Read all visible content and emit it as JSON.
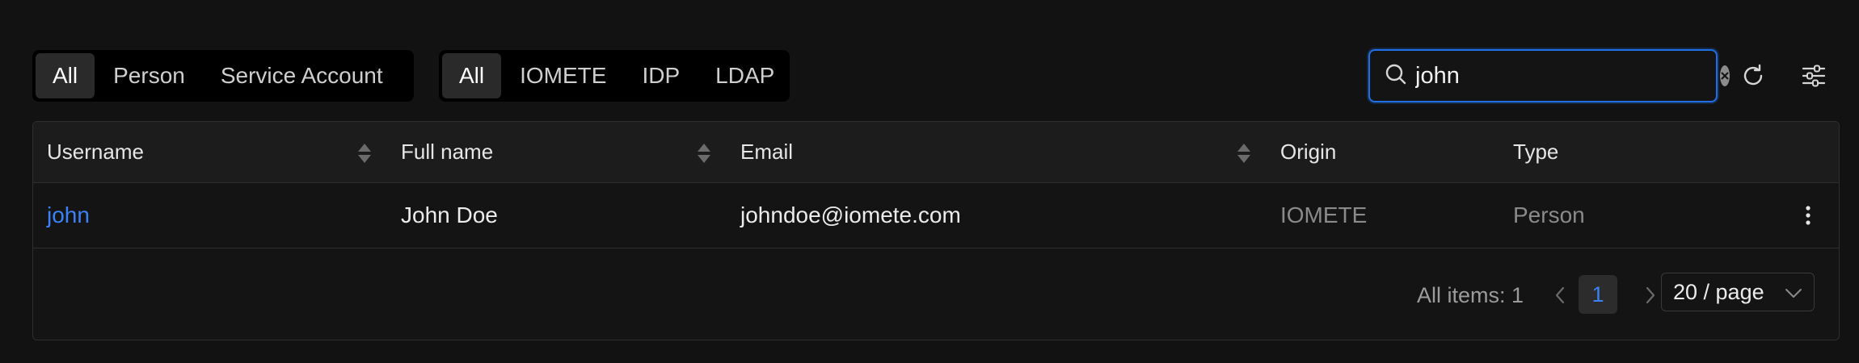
{
  "filters": {
    "type_tabs": [
      {
        "label": "All",
        "active": true
      },
      {
        "label": "Person",
        "active": false
      },
      {
        "label": "Service Account",
        "active": false
      }
    ],
    "origin_tabs": [
      {
        "label": "All",
        "active": true
      },
      {
        "label": "IOMETE",
        "active": false
      },
      {
        "label": "IDP",
        "active": false
      },
      {
        "label": "LDAP",
        "active": false
      }
    ]
  },
  "search": {
    "value": "john",
    "icon": "search-icon",
    "clear_icon": "clear-icon"
  },
  "toolbar": {
    "refresh_icon": "refresh-icon",
    "settings_icon": "column-settings-icon"
  },
  "table": {
    "columns": [
      {
        "label": "Username",
        "sortable": true
      },
      {
        "label": "Full name",
        "sortable": true
      },
      {
        "label": "Email",
        "sortable": true
      },
      {
        "label": "Origin",
        "sortable": false
      },
      {
        "label": "Type",
        "sortable": false
      }
    ],
    "rows": [
      {
        "username": "john",
        "full_name": "John Doe",
        "email": "johndoe@iomete.com",
        "origin": "IOMETE",
        "type": "Person"
      }
    ]
  },
  "pagination": {
    "total_label": "All items: 1",
    "current_page": "1",
    "page_size": "20 / page"
  },
  "colors": {
    "accent": "#1f6fe5",
    "link": "#3b82f6",
    "background": "#121212"
  }
}
